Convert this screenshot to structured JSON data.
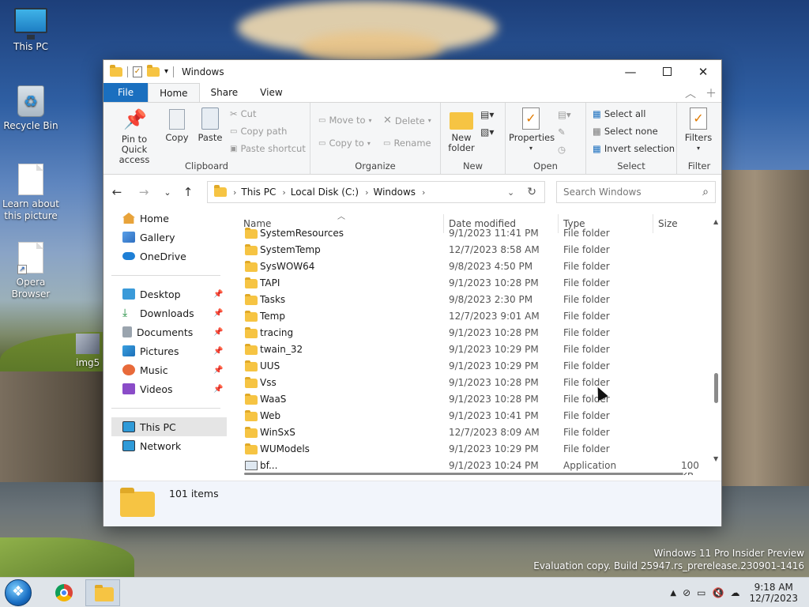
{
  "desktop": {
    "icons": [
      {
        "label": "This PC"
      },
      {
        "label": "Recycle Bin"
      },
      {
        "label": "Learn about this picture"
      },
      {
        "label": "Opera Browser"
      },
      {
        "label": "img5"
      }
    ],
    "watermark_line1": "Windows 11 Pro Insider Preview",
    "watermark_line2": "Evaluation copy. Build 25947.rs_prerelease.230901-1416"
  },
  "window": {
    "title": "Windows",
    "tabs": [
      "File",
      "Home",
      "Share",
      "View"
    ],
    "ribbon": {
      "clipboard": {
        "pin_label": "Pin to Quick access",
        "copy_label": "Copy",
        "paste_label": "Paste",
        "cut_label": "Cut",
        "copy_path_label": "Copy path",
        "paste_shortcut_label": "Paste shortcut",
        "group_label": "Clipboard"
      },
      "organize": {
        "move_to_label": "Move to",
        "copy_to_label": "Copy to",
        "delete_label": "Delete",
        "rename_label": "Rename",
        "group_label": "Organize"
      },
      "new": {
        "new_folder_label": "New folder",
        "group_label": "New"
      },
      "open": {
        "properties_label": "Properties",
        "group_label": "Open"
      },
      "select": {
        "select_all_label": "Select all",
        "select_none_label": "Select none",
        "invert_label": "Invert selection",
        "group_label": "Select"
      },
      "filter": {
        "filters_label": "Filters",
        "group_label": "Filter"
      }
    },
    "address": {
      "crumbs": [
        "This PC",
        "Local Disk (C:)",
        "Windows"
      ],
      "search_placeholder": "Search Windows"
    },
    "nav": {
      "top": [
        "Home",
        "Gallery",
        "OneDrive"
      ],
      "quick": [
        "Desktop",
        "Downloads",
        "Documents",
        "Pictures",
        "Music",
        "Videos"
      ],
      "bottom": [
        "This PC",
        "Network"
      ]
    },
    "columns": {
      "name": "Name",
      "date": "Date modified",
      "type": "Type",
      "size": "Size"
    },
    "files": [
      {
        "name": "SystemResources",
        "date": "9/1/2023 11:41 PM",
        "type": "File folder",
        "size": ""
      },
      {
        "name": "SystemTemp",
        "date": "12/7/2023 8:58 AM",
        "type": "File folder",
        "size": ""
      },
      {
        "name": "SysWOW64",
        "date": "9/8/2023 4:50 PM",
        "type": "File folder",
        "size": ""
      },
      {
        "name": "TAPI",
        "date": "9/1/2023 10:28 PM",
        "type": "File folder",
        "size": ""
      },
      {
        "name": "Tasks",
        "date": "9/8/2023 2:30 PM",
        "type": "File folder",
        "size": ""
      },
      {
        "name": "Temp",
        "date": "12/7/2023 9:01 AM",
        "type": "File folder",
        "size": ""
      },
      {
        "name": "tracing",
        "date": "9/1/2023 10:28 PM",
        "type": "File folder",
        "size": ""
      },
      {
        "name": "twain_32",
        "date": "9/1/2023 10:29 PM",
        "type": "File folder",
        "size": ""
      },
      {
        "name": "UUS",
        "date": "9/1/2023 10:29 PM",
        "type": "File folder",
        "size": ""
      },
      {
        "name": "Vss",
        "date": "9/1/2023 10:28 PM",
        "type": "File folder",
        "size": ""
      },
      {
        "name": "WaaS",
        "date": "9/1/2023 10:28 PM",
        "type": "File folder",
        "size": ""
      },
      {
        "name": "Web",
        "date": "9/1/2023 10:41 PM",
        "type": "File folder",
        "size": ""
      },
      {
        "name": "WinSxS",
        "date": "12/7/2023 8:09 AM",
        "type": "File folder",
        "size": ""
      },
      {
        "name": "WUModels",
        "date": "9/1/2023 10:29 PM",
        "type": "File folder",
        "size": ""
      },
      {
        "name": "bf...",
        "date": "9/1/2023 10:24 PM",
        "type": "Application",
        "size": "100 KB"
      }
    ],
    "status": {
      "item_count": "101 items"
    }
  },
  "taskbar": {
    "time": "9:18 AM",
    "date": "12/7/2023"
  }
}
